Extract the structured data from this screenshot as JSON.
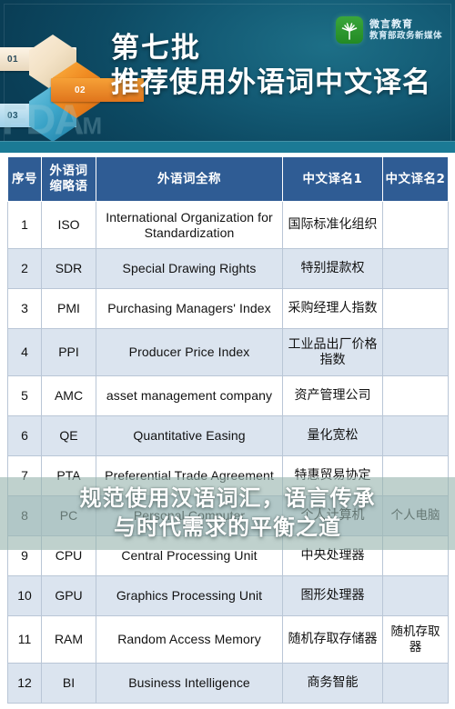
{
  "banner": {
    "headline_line1": "第七批",
    "headline_line2": "推荐使用外语词中文译名",
    "badges": [
      "01",
      "02",
      "03"
    ],
    "watermark": "FDA",
    "watermark_small": "M",
    "brand": {
      "name": "微言教育",
      "subtitle": "教育部政务新媒体",
      "icon": "green-hand-logo-icon",
      "color": "#2f9b30"
    },
    "background_color": "#0d4a63",
    "accent_color": "#1b7a95"
  },
  "overlay": {
    "line1": "规范使用汉语词汇，语言传承",
    "line2": "与时代需求的平衡之道",
    "band_color": "#98b4af"
  },
  "table": {
    "header_color": "#2f5c94",
    "stripe_color": "#dbe4ef",
    "columns": [
      "序号",
      "外语词\n缩略语",
      "外语词全称",
      "中文译名1",
      "中文译名2"
    ],
    "columns_flat": {
      "c1": "序号",
      "c2_l1": "外语词",
      "c2_l2": "缩略语",
      "c3": "外语词全称",
      "c4": "中文译名1",
      "c5": "中文译名2"
    },
    "rows": [
      {
        "num": "1",
        "abbr": "ISO",
        "full": "International Organization for Standardization",
        "cn1": "国际标准化组织",
        "cn2": ""
      },
      {
        "num": "2",
        "abbr": "SDR",
        "full": "Special Drawing Rights",
        "cn1": "特别提款权",
        "cn2": ""
      },
      {
        "num": "3",
        "abbr": "PMI",
        "full": "Purchasing Managers' Index",
        "cn1": "采购经理人指数",
        "cn2": ""
      },
      {
        "num": "4",
        "abbr": "PPI",
        "full": "Producer Price Index",
        "cn1": "工业品出厂价格指数",
        "cn2": ""
      },
      {
        "num": "5",
        "abbr": "AMC",
        "full": "asset management company",
        "cn1": "资产管理公司",
        "cn2": ""
      },
      {
        "num": "6",
        "abbr": "QE",
        "full": "Quantitative Easing",
        "cn1": "量化宽松",
        "cn2": ""
      },
      {
        "num": "7",
        "abbr": "PTA",
        "full": "Preferential Trade Agreement",
        "cn1": "特惠贸易协定",
        "cn2": ""
      },
      {
        "num": "8",
        "abbr": "PC",
        "full": "Personal Computer",
        "cn1": "个人计算机",
        "cn2": "个人电脑"
      },
      {
        "num": "9",
        "abbr": "CPU",
        "full": "Central Processing Unit",
        "cn1": "中央处理器",
        "cn2": ""
      },
      {
        "num": "10",
        "abbr": "GPU",
        "full": "Graphics Processing Unit",
        "cn1": "图形处理器",
        "cn2": ""
      },
      {
        "num": "11",
        "abbr": "RAM",
        "full": "Random Access Memory",
        "cn1": "随机存取存储器",
        "cn2": "随机存取器"
      },
      {
        "num": "12",
        "abbr": "BI",
        "full": "Business Intelligence",
        "cn1": "商务智能",
        "cn2": ""
      }
    ]
  }
}
